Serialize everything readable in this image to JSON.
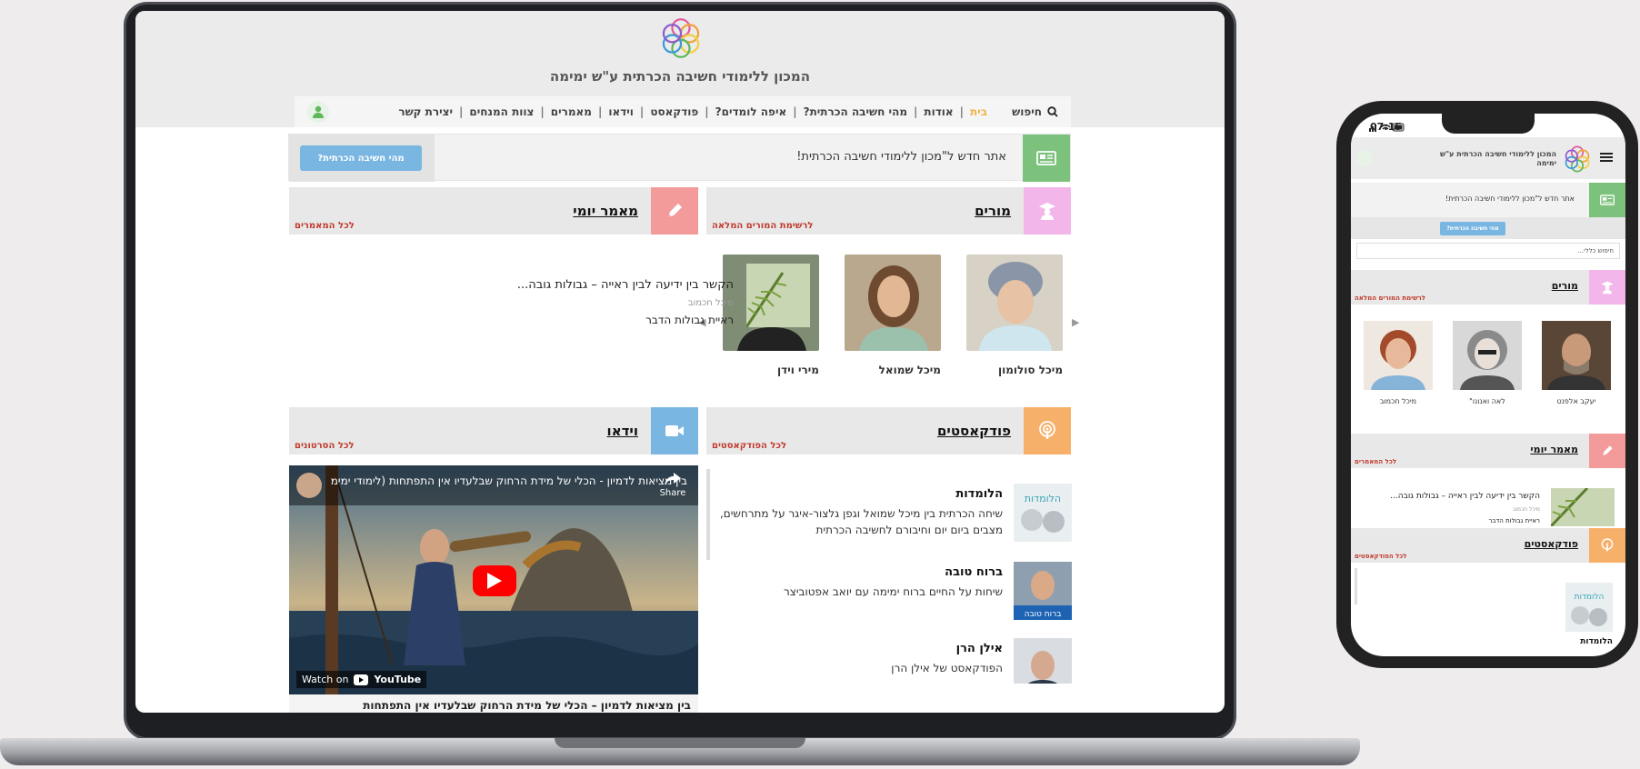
{
  "site": {
    "title": "המכון ללימודי חשיבה הכרתית ע\"ש ימימה"
  },
  "nav": {
    "search_label": "חיפוש",
    "items": [
      "בית",
      "אודות",
      "מהי חשיבה הכרתית?",
      "איפה לומדים?",
      "פודקאסט",
      "וידאו",
      "מאמרים",
      "צוות המנחים",
      "יצירת קשר"
    ],
    "active_index": 0
  },
  "banner": {
    "text": "אתר חדש ל\"מכון ללימודי חשיבה הכרתית!",
    "button_label": "מהי חשיבה הכרתית?"
  },
  "teachers_section": {
    "title": "מורים",
    "more_link": "לרשימת המורים המלאה",
    "teachers": [
      {
        "name": "מיכל סולומון"
      },
      {
        "name": "מיכל שמואל"
      },
      {
        "name": "מירי וידן"
      }
    ]
  },
  "articles_section": {
    "title": "מאמר יומי",
    "more_link": "לכל המאמרים",
    "article": {
      "title": "הקשר בין ידיעה לבין ראייה – גבולות גובה...",
      "author": "מיכל חכמוב",
      "subtitle": "ראיית גבולות הדבר"
    }
  },
  "podcasts_section": {
    "title": "פודקאסטים",
    "more_link": "לכל הפודקאסטים",
    "podcasts": [
      {
        "name": "הלומדות",
        "description": "שיחה הכרתית בין מיכל שמואל וגפן גלצור-איגר על מתרחשים, מצבים ביום יום וחיבורם לחשיבה הכרתית",
        "thumb_text": "הלומדות"
      },
      {
        "name": "ברוח טובה",
        "description": "שיחות על החיים ברוח ימימה עם יואב אפטוביצר",
        "thumb_text": "ברוח טובה"
      },
      {
        "name": "אילן הרן",
        "description": "הפודקאסט של אילן הרן",
        "thumb_text": ""
      }
    ]
  },
  "video_section": {
    "title": "וידאו",
    "more_link": "לכל הסרטונים",
    "video_title": "בין מציאות לדמיון - הכלי של מידת הרחוק שבלעדיו אין התפתחות (לימודי ימימה)",
    "share_label": "Share",
    "watch_on": "Watch on",
    "youtube_label": "YouTube",
    "caption": "בין מציאות לדמיון – הכלי של מידת הרחוק שבלעדיו אין התפתחות"
  },
  "phone": {
    "time": "07:15",
    "site_title": "המכון ללימודי חשיבה הכרתית ע\"ש ימימה",
    "banner_text": "אתר חדש ל\"מכון ללימודי חשיבה הכרתית!",
    "button_label": "מהי חשיבה הכרתית?",
    "search_placeholder": "חיפוש כללי...",
    "teachers_title": "מורים",
    "teachers_more": "לרשימת המורים המלאה",
    "teachers": [
      {
        "name": "יעקב אלפנט"
      },
      {
        "name": "לאה ואנונו\""
      },
      {
        "name": "מיכל חכמוב"
      }
    ],
    "articles_title": "מאמר יומי",
    "articles_more": "לכל המאמרים",
    "article_title": "הקשר בין ידיעה לבין ראייה – גבולות גובה...",
    "article_author": "מיכל חכמוב",
    "article_sub": "ראיית גבולות הדבר",
    "podcasts_title": "פודקאסטים",
    "podcasts_more": "לכל הפודקאסטים",
    "podcast_name": "הלומדות",
    "podcast_thumb_text": "הלומדות"
  },
  "colors": {
    "teachers_icon": "#f2b6ea",
    "articles_icon": "#f39a9a",
    "podcasts_icon": "#f6b06a",
    "video_icon": "#7ab6e2",
    "banner_icon": "#7cc27c",
    "more_link": "#c0392b",
    "nav_active": "#f0b24a"
  }
}
